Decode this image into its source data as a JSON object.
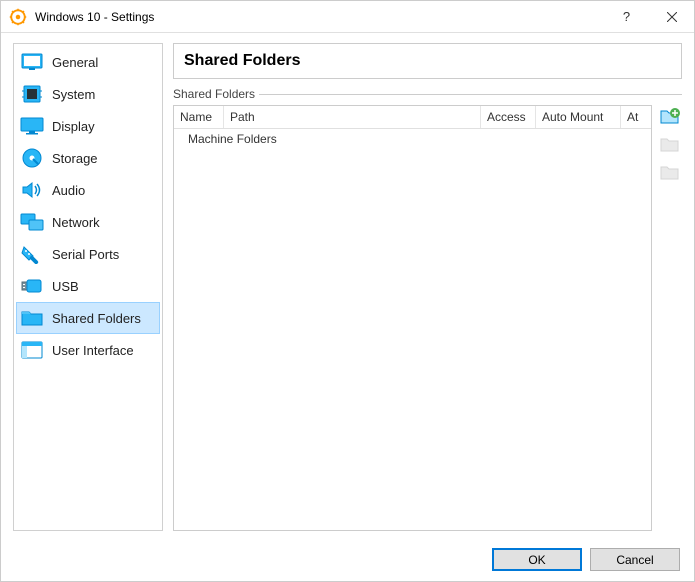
{
  "window": {
    "title": "Windows 10 - Settings"
  },
  "sidebar": {
    "items": [
      {
        "label": "General",
        "icon": "general"
      },
      {
        "label": "System",
        "icon": "system"
      },
      {
        "label": "Display",
        "icon": "display"
      },
      {
        "label": "Storage",
        "icon": "storage"
      },
      {
        "label": "Audio",
        "icon": "audio"
      },
      {
        "label": "Network",
        "icon": "network"
      },
      {
        "label": "Serial Ports",
        "icon": "serial"
      },
      {
        "label": "USB",
        "icon": "usb"
      },
      {
        "label": "Shared Folders",
        "icon": "folder"
      },
      {
        "label": "User Interface",
        "icon": "ui"
      }
    ]
  },
  "main": {
    "title": "Shared Folders",
    "group_label": "Shared Folders",
    "columns": {
      "name": "Name",
      "path": "Path",
      "access": "Access",
      "auto_mount": "Auto Mount",
      "at": "At"
    },
    "placeholder_row": "Machine Folders"
  },
  "footer": {
    "ok": "OK",
    "cancel": "Cancel"
  }
}
